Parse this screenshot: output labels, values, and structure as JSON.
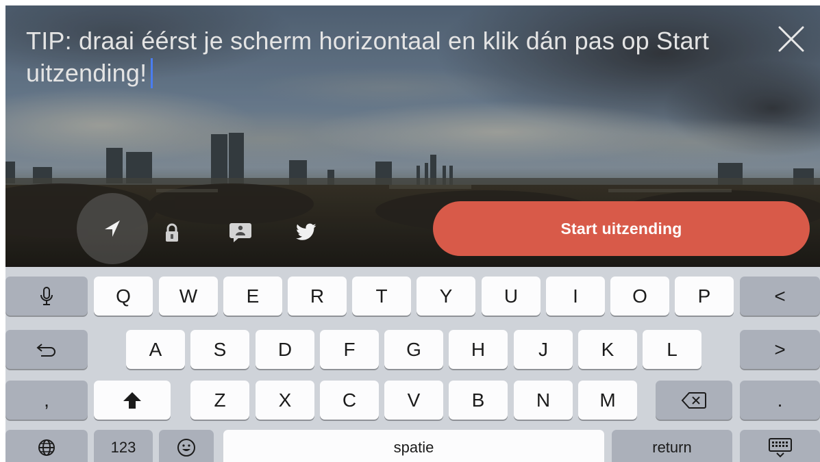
{
  "tip": {
    "text": "TIP: draai éérst je scherm horizontaal en klik dán pas op Start uitzending!"
  },
  "toolbar": {
    "icons": [
      "location-arrow-icon",
      "lock-icon",
      "chat-bubble-icon",
      "twitter-bird-icon",
      "close-icon"
    ],
    "start_button_label": "Start uitzending"
  },
  "keyboard": {
    "row1": [
      "Q",
      "W",
      "E",
      "R",
      "T",
      "Y",
      "U",
      "I",
      "O",
      "P"
    ],
    "row2": [
      "A",
      "S",
      "D",
      "F",
      "G",
      "H",
      "J",
      "K",
      "L"
    ],
    "row3": [
      "Z",
      "X",
      "C",
      "V",
      "B",
      "N",
      "M"
    ],
    "left_column": [
      "microphone-icon",
      "undo-icon",
      ",",
      "globe-icon"
    ],
    "right_column": [
      "<",
      ">",
      ".",
      "keyboard-dismiss-icon"
    ],
    "shift_icon": "shift-arrow-icon",
    "backspace_icon": "backspace-icon",
    "numbers_label": "123",
    "emoji_icon": "emoji-icon",
    "space_label": "spatie",
    "return_label": "return"
  },
  "colors": {
    "start_button": "#d85a49",
    "caret": "#4a7df0",
    "keyboard_background": "#cfd3d9",
    "key_light": "#fcfcfd",
    "key_dark": "#abb0ba"
  }
}
